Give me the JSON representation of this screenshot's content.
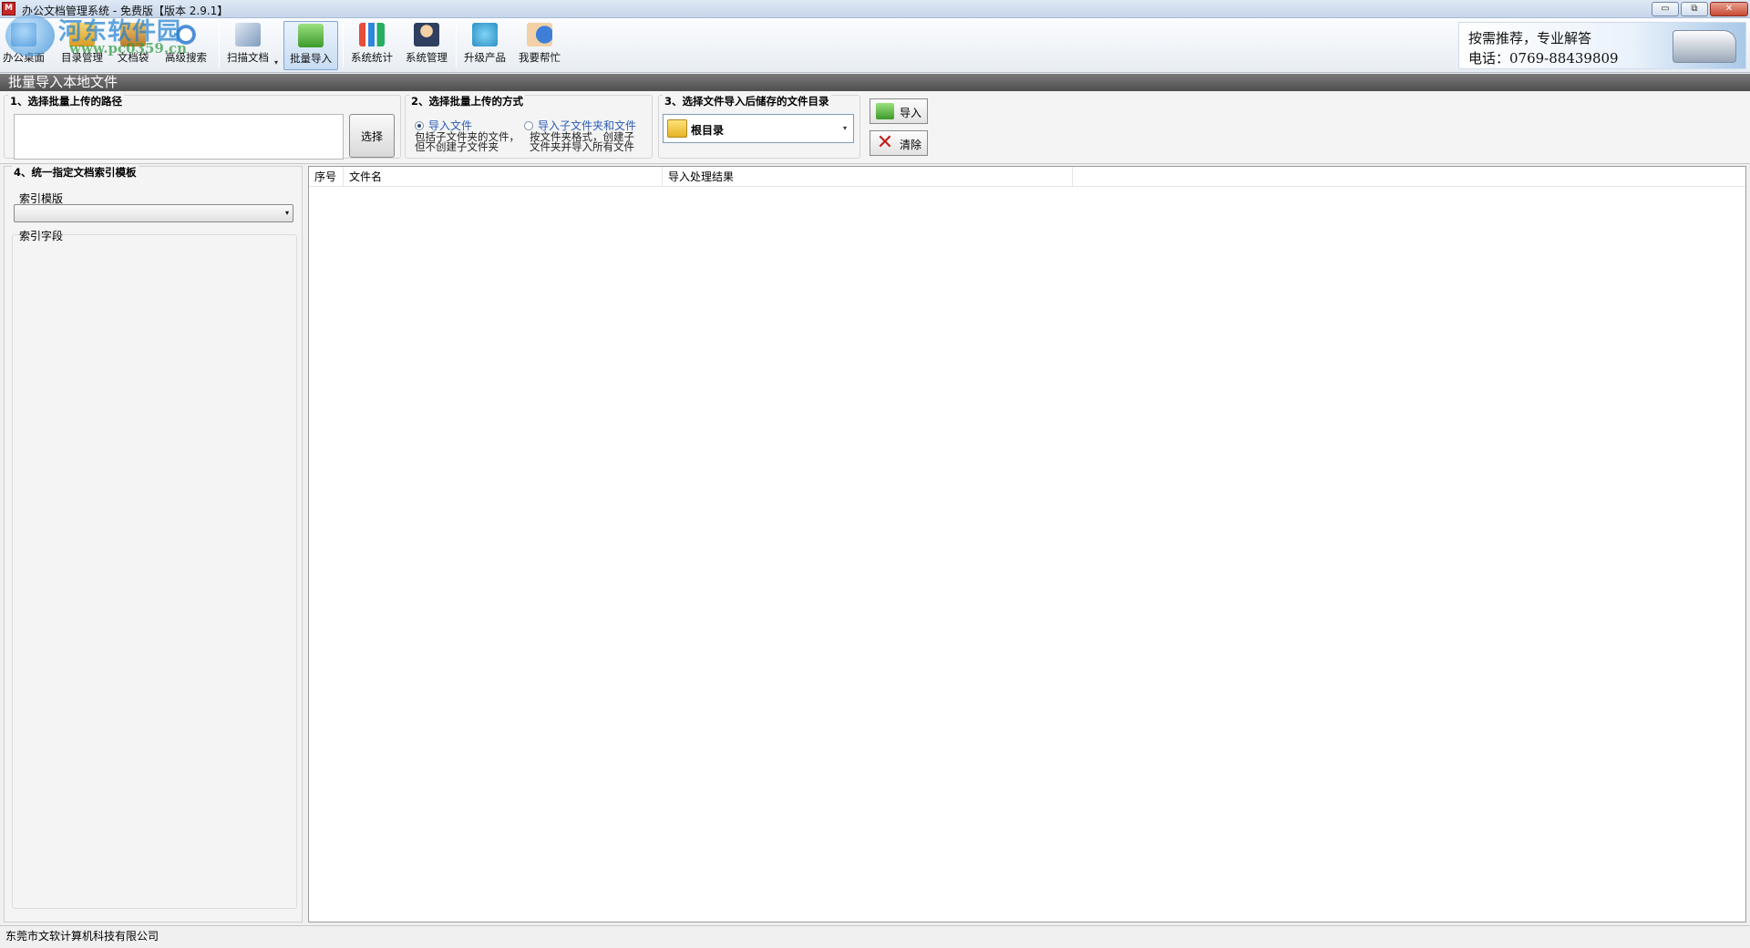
{
  "window": {
    "title": "办公文档管理系统 - 免费版【版本 2.9.1】",
    "app_icon_text": "M",
    "minimize": "▭",
    "restore": "⧉",
    "close": "✕"
  },
  "toolbar": {
    "items": [
      {
        "label": "办公桌面",
        "icon": "home-icon"
      },
      {
        "label": "目录管理",
        "icon": "directory-icon"
      },
      {
        "label": "文档袋",
        "icon": "document-bag-icon"
      },
      {
        "label": "高级搜索",
        "icon": "search-icon"
      },
      {
        "label": "扫描文档",
        "icon": "scan-icon"
      },
      {
        "label": "批量导入",
        "icon": "batch-import-icon",
        "active": true
      },
      {
        "label": "系统统计",
        "icon": "stats-icon"
      },
      {
        "label": "系统管理",
        "icon": "admin-icon"
      },
      {
        "label": "升级产品",
        "icon": "upgrade-icon"
      },
      {
        "label": "我要帮忙",
        "icon": "help-icon"
      }
    ],
    "scan_dropdown_arrow": "▾"
  },
  "ad": {
    "line1": "按需推荐，专业解答",
    "line2": "电话：0769-88439809"
  },
  "watermark": {
    "name": "河东软件园",
    "url": "www.pc0359.cn"
  },
  "section": {
    "title": "批量导入本地文件"
  },
  "step1": {
    "title": "1、选择批量上传的路径",
    "path_value": "",
    "choose_button": "选择"
  },
  "step2": {
    "title": "2、选择批量上传的方式",
    "option1_label": "导入文件",
    "option1_desc_line1": "包括子文件夹的文件，",
    "option1_desc_line2": "但不创建子文件夹",
    "option2_label": "导入子文件夹和文件",
    "option2_desc_line1": "按文件夹格式，创建子",
    "option2_desc_line2": "文件夹并导入所有文件",
    "selected": "option1"
  },
  "step3": {
    "title": "3、选择文件导入后储存的文件目录",
    "selected_dir": "根目录",
    "arrow": "▾"
  },
  "actions": {
    "import_label": "导入",
    "clear_label": "清除",
    "clear_glyph": "✕"
  },
  "step4": {
    "title": "4、统一指定文档索引模板",
    "template_label": "索引模版",
    "template_value": "",
    "template_arrow": "▾",
    "fields_label": "索引字段"
  },
  "results": {
    "columns": [
      "序号",
      "文件名",
      "导入处理结果",
      ""
    ],
    "rows": []
  },
  "status": {
    "company": "东莞市文软计算机科技有限公司"
  }
}
